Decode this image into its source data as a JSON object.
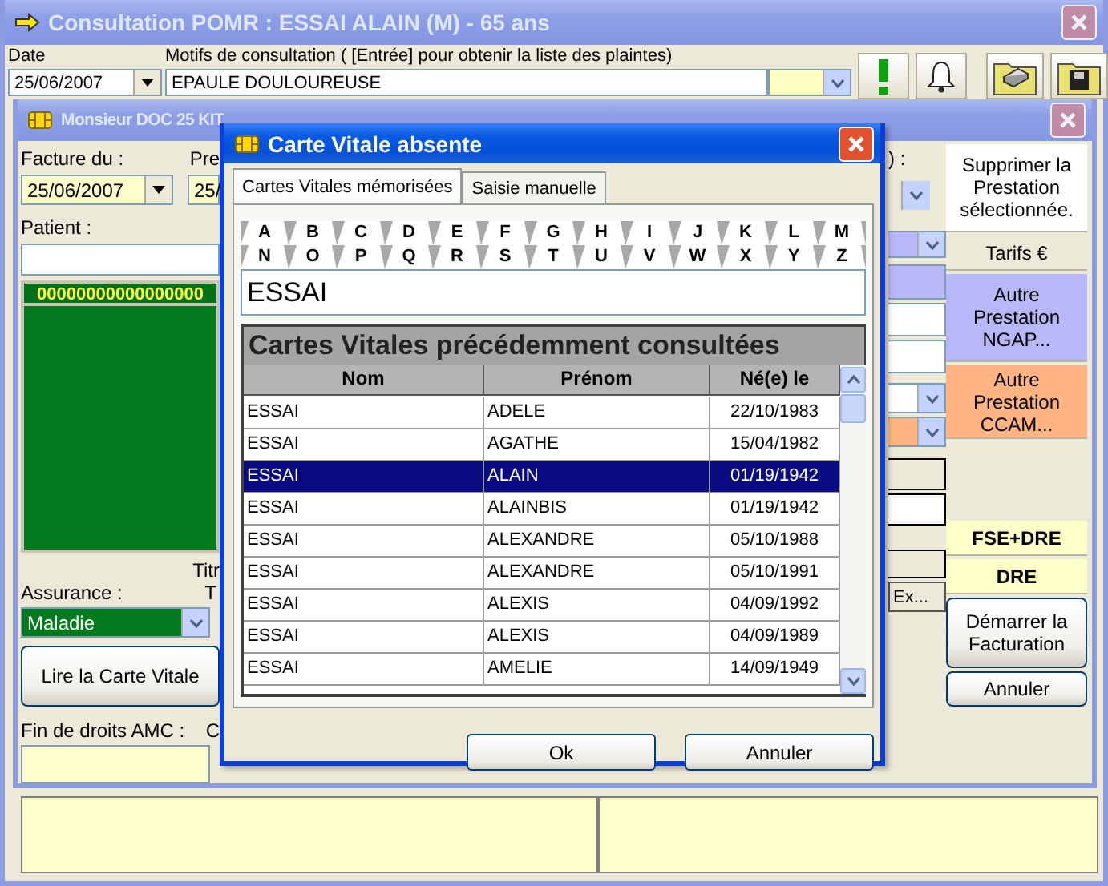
{
  "main_window": {
    "title": "Consultation POMR : ESSAI ALAIN (M) -  65 ans",
    "date_label": "Date",
    "motifs_label": "Motifs de consultation ( [Entrée]  pour obtenir la liste des plaintes)",
    "date": "25/06/2007",
    "motif": "EPAULE DOULOUREUSE"
  },
  "billing_window": {
    "title": "Monsieur DOC 25 KIT",
    "facture_label": "Facture du :",
    "facture_date": "25/06/2007",
    "label_2": "Pre",
    "field_2": "25/",
    "patient_label": "Patient :",
    "card_number": "00000000000000000",
    "label_3": "Titr",
    "assurance_label": "Assurance :",
    "label_4": "T",
    "assurance": "Maladie",
    "read_card_button": "Lire la Carte Vitale",
    "fin_droits_label": "Fin de droits AMC :",
    "label_5": "C",
    "label_6": ") :",
    "ex_button": "Ex...",
    "side_top": [
      {
        "label": "Supprimer la Prestation sélectionnée.",
        "kind": "panel",
        "color": "#ffffff"
      },
      {
        "label": "Tarifs €",
        "kind": "panel",
        "color": "#ece9d8"
      },
      {
        "label": "Autre Prestation NGAP...",
        "kind": "panel",
        "color": "#b8b8f8"
      },
      {
        "label": "Autre Prestation CCAM...",
        "kind": "panel",
        "color": "#ffb482"
      }
    ],
    "side_bottom": [
      {
        "label": "FSE+DRE",
        "kind": "flag",
        "color": "#ffffc8"
      },
      {
        "label": "DRE",
        "kind": "flag",
        "color": "#ffffc8"
      },
      {
        "label": "Démarrer la Facturation",
        "kind": "push"
      },
      {
        "label": "Annuler",
        "kind": "push"
      }
    ]
  },
  "dialog": {
    "title": "Carte Vitale absente",
    "tabs": [
      {
        "label": "Cartes Vitales mémorisées",
        "selected": true
      },
      {
        "label": "Saisie manuelle",
        "selected": false
      }
    ],
    "letters": [
      [
        "A",
        "B",
        "C",
        "D",
        "E",
        "F",
        "G",
        "H",
        "I",
        "J",
        "K",
        "L",
        "M"
      ],
      [
        "N",
        "O",
        "P",
        "Q",
        "R",
        "S",
        "T",
        "U",
        "V",
        "W",
        "X",
        "Y",
        "Z"
      ]
    ],
    "search": "ESSAI",
    "table": {
      "caption": "Cartes Vitales précédemment consultées",
      "columns": [
        "Nom",
        "Prénom",
        "Né(e) le"
      ],
      "rows": [
        {
          "cells": [
            "ESSAI",
            "ADELE",
            "22/10/1983"
          ],
          "selected": false
        },
        {
          "cells": [
            "ESSAI",
            "AGATHE",
            "15/04/1982"
          ],
          "selected": false
        },
        {
          "cells": [
            "ESSAI",
            "ALAIN",
            "01/19/1942"
          ],
          "selected": true
        },
        {
          "cells": [
            "ESSAI",
            "ALAINBIS",
            "01/19/1942"
          ],
          "selected": false
        },
        {
          "cells": [
            "ESSAI",
            "ALEXANDRE",
            "05/10/1988"
          ],
          "selected": false
        },
        {
          "cells": [
            "ESSAI",
            "ALEXANDRE",
            "05/10/1991"
          ],
          "selected": false
        },
        {
          "cells": [
            "ESSAI",
            "ALEXIS",
            "04/09/1992"
          ],
          "selected": false
        },
        {
          "cells": [
            "ESSAI",
            "ALEXIS",
            "04/09/1989"
          ],
          "selected": false
        },
        {
          "cells": [
            "ESSAI",
            "AMELIE",
            "14/09/1949"
          ],
          "selected": false
        }
      ]
    },
    "buttons": [
      "Ok",
      "Annuler"
    ]
  }
}
